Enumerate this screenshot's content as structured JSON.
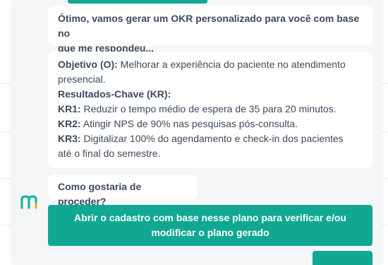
{
  "chat": {
    "intro_message": "Ótimo, vamos gerar um OKR personalizado para você com base no que me respondeu...",
    "intro_line1": "Ótimo, vamos gerar um OKR personalizado para você com base no",
    "intro_line2": "que me respondeu...",
    "okr": {
      "objective_label": "Objetivo (O):",
      "objective_text_line1": " Melhorar a experiência do paciente no atendimento",
      "objective_text_line2": "presencial.",
      "key_results_heading": "Resultados-Chave (KR):",
      "kr1_label": "KR1:",
      "kr1_text": " Reduzir o tempo médio de espera de 35 para 20 minutos.",
      "kr2_label": "KR2:",
      "kr2_text": " Atingir NPS de 90% nas pesquisas pós-consulta.",
      "kr3_label": "KR3:",
      "kr3_text_line1": " Digitalizar 100% do agendamento e check-in dos pacientes",
      "kr3_text_line2": "até o final do semestre."
    },
    "question": "Como gostaria de proceder?",
    "action_line1": "Abrir o cadastro com base nesse plano para verificar e/ou",
    "action_line2": "modificar o plano gerado"
  },
  "colors": {
    "accent": "#11a893",
    "text": "#3d4a5c",
    "panel_bg": "#f5f6f8",
    "avatar_teal": "#1fb5a0",
    "avatar_orange": "#f5a623"
  },
  "icons": {
    "avatar": "assistant-logo-icon"
  }
}
